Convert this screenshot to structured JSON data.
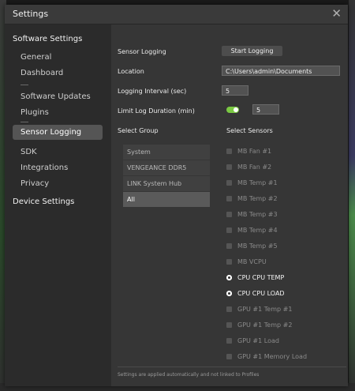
{
  "window": {
    "title": "Settings"
  },
  "sidebar": {
    "software_header": "Software Settings",
    "items": [
      {
        "label": "General"
      },
      {
        "label": "Dashboard"
      },
      {
        "label": "Software Updates"
      },
      {
        "label": "Plugins"
      },
      {
        "label": "Sensor Logging",
        "selected": true
      },
      {
        "label": "SDK"
      },
      {
        "label": "Integrations"
      },
      {
        "label": "Privacy"
      }
    ],
    "device_header": "Device Settings"
  },
  "sensor_logging": {
    "section_label": "Sensor Logging",
    "start_button": "Start Logging",
    "location_label": "Location",
    "location_value": "C:\\Users\\admin\\Documents",
    "interval_label": "Logging Interval (sec)",
    "interval_value": "5",
    "limit_label": "Limit Log Duration (min)",
    "limit_enabled": true,
    "limit_value": "5",
    "select_group_label": "Select Group",
    "groups": [
      "System",
      "VENGEANCE DDR5",
      "LINK System Hub",
      "All"
    ],
    "selected_group": "All",
    "select_sensors_label": "Select Sensors",
    "sensors": [
      {
        "name": "MB Fan #1",
        "checked": false
      },
      {
        "name": "MB Fan #2",
        "checked": false
      },
      {
        "name": "MB Temp #1",
        "checked": false
      },
      {
        "name": "MB Temp #2",
        "checked": false
      },
      {
        "name": "MB Temp #3",
        "checked": false
      },
      {
        "name": "MB Temp #4",
        "checked": false
      },
      {
        "name": "MB Temp #5",
        "checked": false
      },
      {
        "name": "MB VCPU",
        "checked": false
      },
      {
        "name": "CPU CPU TEMP",
        "checked": true
      },
      {
        "name": "CPU CPU LOAD",
        "checked": true
      },
      {
        "name": "GPU #1 Temp #1",
        "checked": false
      },
      {
        "name": "GPU #1 Temp #2",
        "checked": false
      },
      {
        "name": "GPU #1 Load",
        "checked": false
      },
      {
        "name": "GPU #1 Memory Load",
        "checked": false
      }
    ],
    "footer_note": "Settings are applied automatically and not linked to Profiles"
  },
  "colors": {
    "accent_toggle": "#7ac943",
    "dialog_bg": "#2f2f2f",
    "selected_item": "#555555"
  }
}
